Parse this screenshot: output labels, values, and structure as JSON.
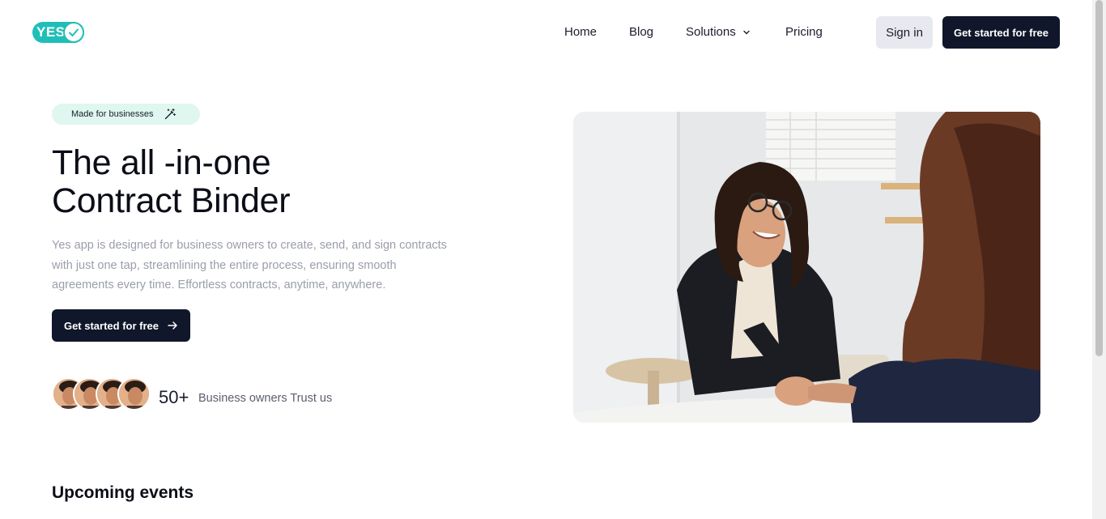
{
  "header": {
    "logo_text": "YES",
    "nav": {
      "home": "Home",
      "blog": "Blog",
      "solutions": "Solutions",
      "pricing": "Pricing"
    },
    "signin_label": "Sign in",
    "cta_label": "Get started for free"
  },
  "hero": {
    "badge": "Made for businesses",
    "title_line1": "The all -in-one",
    "title_line2": "Contract Binder",
    "description": "Yes app is designed for business owners to create, send, and sign contracts with just one tap, streamlining the entire process, ensuring smooth agreements every time. Effortless contracts, anytime, anywhere.",
    "cta_label": "Get started for free",
    "trust_count": "50+",
    "trust_text": "Business owners Trust us"
  },
  "upcoming": {
    "title": "Upcoming events"
  },
  "colors": {
    "brand": "#1fbfb8",
    "dark_button": "#10172a",
    "badge_bg": "#dff7ef"
  },
  "icons": {
    "logo_check": "check-icon",
    "solutions_chevron": "chevron-down-icon",
    "badge_icon": "magic-wand-icon",
    "cta_arrow": "arrow-right-icon"
  }
}
